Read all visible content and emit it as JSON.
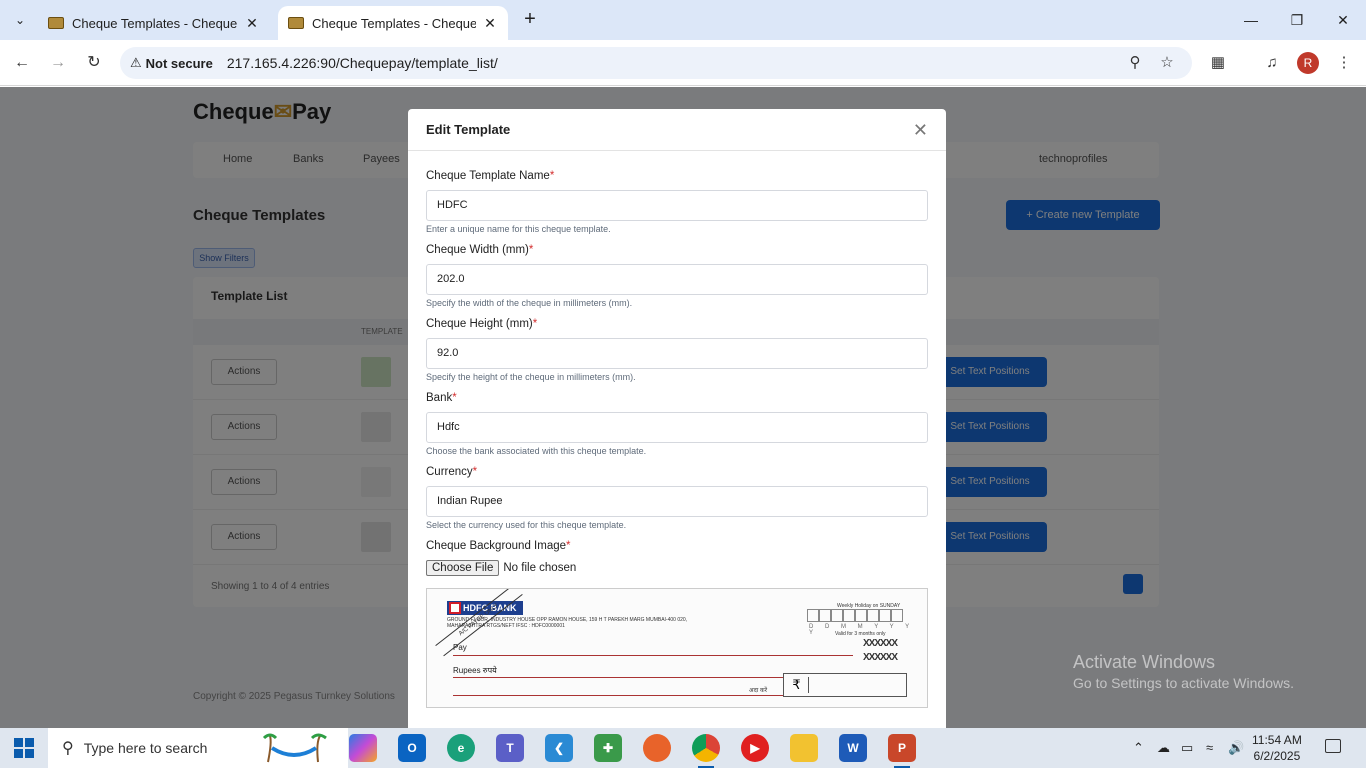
{
  "browser": {
    "tabs": [
      {
        "title": "Cheque Templates - Cheque Pay"
      },
      {
        "title": "Cheque Templates - Cheque Pay"
      }
    ],
    "security_label": "Not secure",
    "url": "217.165.4.226:90/Chequepay/template_list/",
    "profile_initial": "R"
  },
  "page": {
    "brand_left": "Cheque",
    "brand_mid": "✉",
    "brand_right": "Pay",
    "nav": [
      "Home",
      "Banks",
      "Payees",
      "technoprofiles"
    ],
    "title": "Cheque Templates",
    "create_button": "+ Create new Template",
    "filter_chip": "Show Filters",
    "card_title": "Template List",
    "col_header": "TEMPLATE",
    "row_action": "Actions",
    "position_button": "Set Text Positions",
    "footer": "Showing 1 to 4 of 4 entries",
    "copyright": "Copyright © 2025 Pegasus Turnkey Solutions"
  },
  "modal": {
    "title": "Edit Template",
    "fields": {
      "name": {
        "label": "Cheque Template Name",
        "value": "HDFC",
        "help": "Enter a unique name for this cheque template."
      },
      "width": {
        "label": "Cheque Width (mm)",
        "value": "202.0",
        "help": "Specify the width of the cheque in millimeters (mm)."
      },
      "height": {
        "label": "Cheque Height (mm)",
        "value": "92.0",
        "help": "Specify the height of the cheque in millimeters (mm)."
      },
      "bank": {
        "label": "Bank",
        "value": "Hdfc",
        "help": "Choose the bank associated with this cheque template."
      },
      "currency": {
        "label": "Currency",
        "value": "Indian Rupee",
        "help": "Select the currency used for this cheque template."
      },
      "image": {
        "label": "Cheque Background Image",
        "choose_button": "Choose File",
        "status": "No file chosen"
      }
    },
    "required_marker": "*",
    "cheque_preview": {
      "bank_logo": "HDFC BANK",
      "address": "GROUND FLOOR, INDUSTRY HOUSE OPP RAMON HOUSE, 159 H T PAREKH MARG MUMBAI-400 020, MAHARASHTRA RTGS/NEFT IFSC : HDFC0000001",
      "holiday": "Weekly Holiday on SUNDAY",
      "date_format": "D D M M Y Y Y Y",
      "valid": "Valid for 3 months only",
      "mask": "XXXXXX",
      "pay": "Pay",
      "rupees": "Rupees रुपये",
      "ada": "अदा करें",
      "rupee_symbol": "₹",
      "stamp": "A/C PAYEE ONLY"
    }
  },
  "watermark": {
    "line1": "Activate Windows",
    "line2": "Go to Settings to activate Windows."
  },
  "taskbar": {
    "search_placeholder": "Type here to search",
    "time": "11:54 AM",
    "date": "6/2/2025"
  }
}
